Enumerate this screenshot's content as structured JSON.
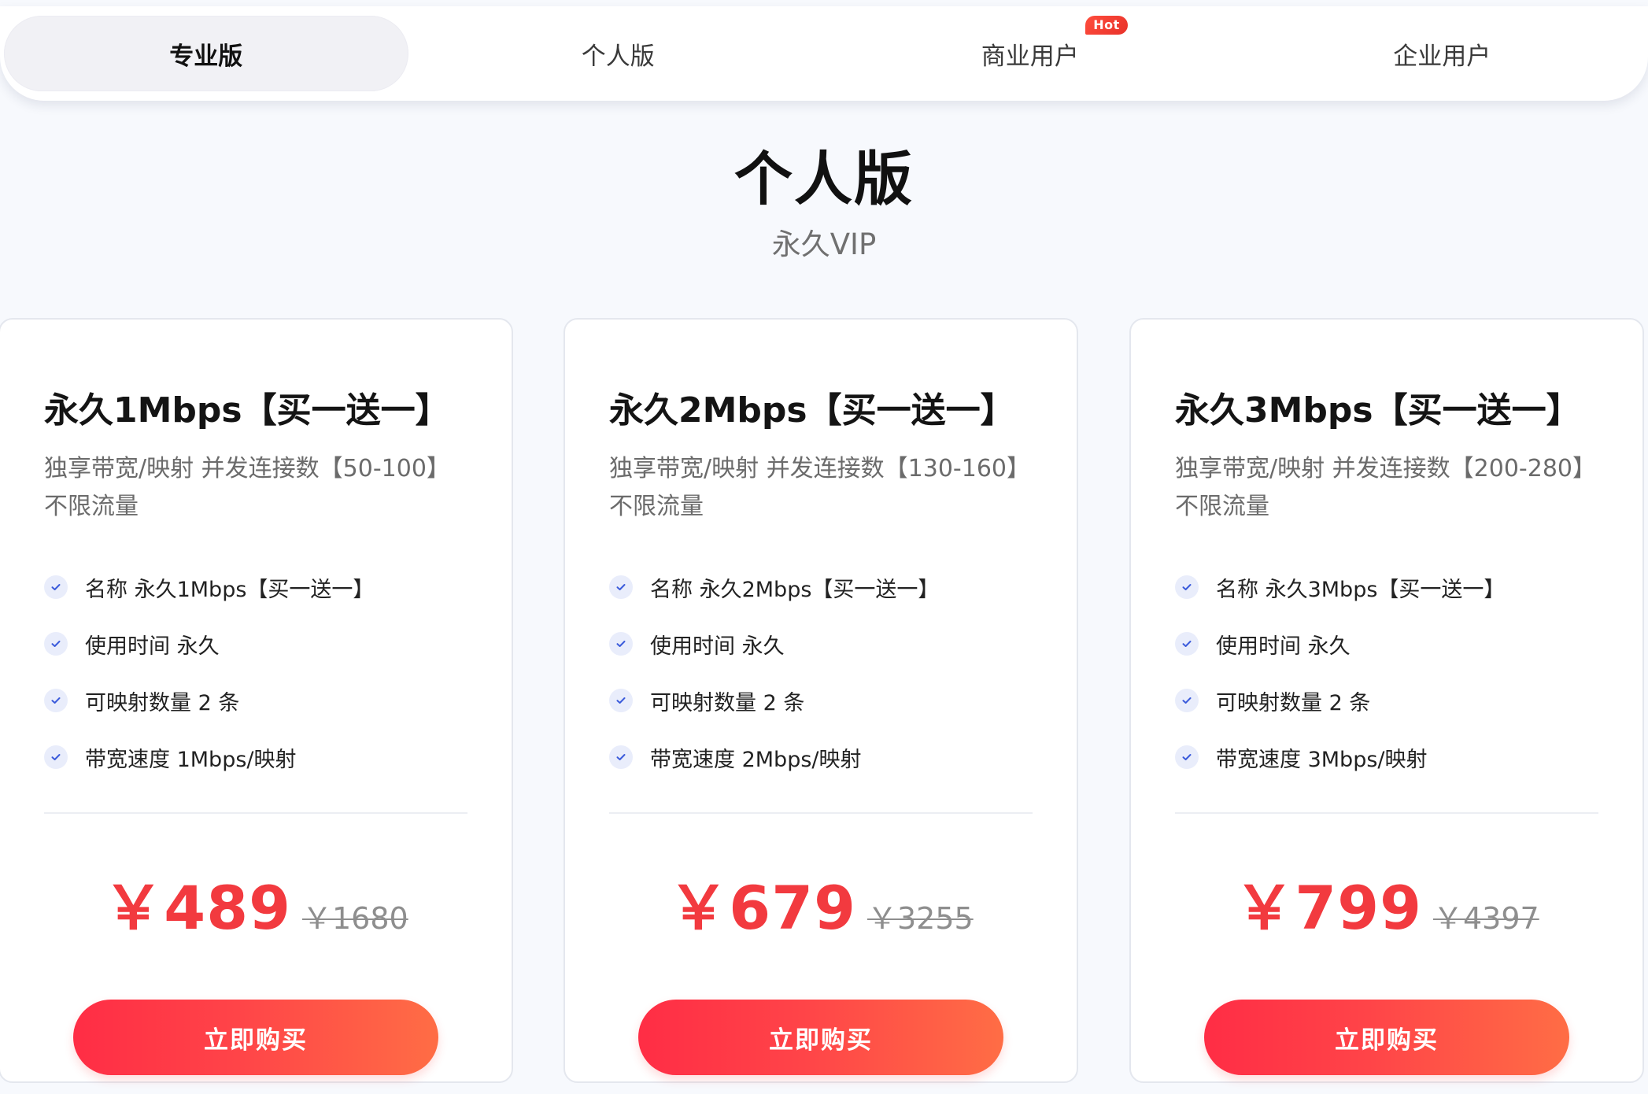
{
  "tabs": [
    {
      "label": "专业版",
      "active": true
    },
    {
      "label": "个人版",
      "active": false
    },
    {
      "label": "商业用户",
      "active": false,
      "badge": "Hot"
    },
    {
      "label": "企业用户",
      "active": false
    }
  ],
  "heading": {
    "title": "个人版",
    "subtitle": "永久VIP"
  },
  "plans": [
    {
      "name": "永久1Mbps【买一送一】",
      "description": "独享带宽/映射 并发连接数【50-100】不限流量",
      "features": [
        "名称 永久1Mbps【买一送一】",
        "使用时间 永久",
        "可映射数量 2 条",
        "带宽速度 1Mbps/映射"
      ],
      "price": "￥489",
      "original_price": "￥1680",
      "button_label": "立即购买"
    },
    {
      "name": "永久2Mbps【买一送一】",
      "description": "独享带宽/映射 并发连接数【130-160】不限流量",
      "features": [
        "名称 永久2Mbps【买一送一】",
        "使用时间 永久",
        "可映射数量 2 条",
        "带宽速度 2Mbps/映射"
      ],
      "price": "￥679",
      "original_price": "￥3255",
      "button_label": "立即购买"
    },
    {
      "name": "永久3Mbps【买一送一】",
      "description": "独享带宽/映射 并发连接数【200-280】不限流量",
      "features": [
        "名称 永久3Mbps【买一送一】",
        "使用时间 永久",
        "可映射数量 2 条",
        "带宽速度 3Mbps/映射"
      ],
      "price": "￥799",
      "original_price": "￥4397",
      "button_label": "立即购买"
    }
  ],
  "colors": {
    "accent_red": "#f23a3f",
    "button_gradient_start": "#ff2d45",
    "button_gradient_end": "#ff6d45",
    "check_icon": "#3b5bdb",
    "hot_badge": "#e8322a"
  },
  "icons": {
    "feature_bullet": "check-icon"
  }
}
